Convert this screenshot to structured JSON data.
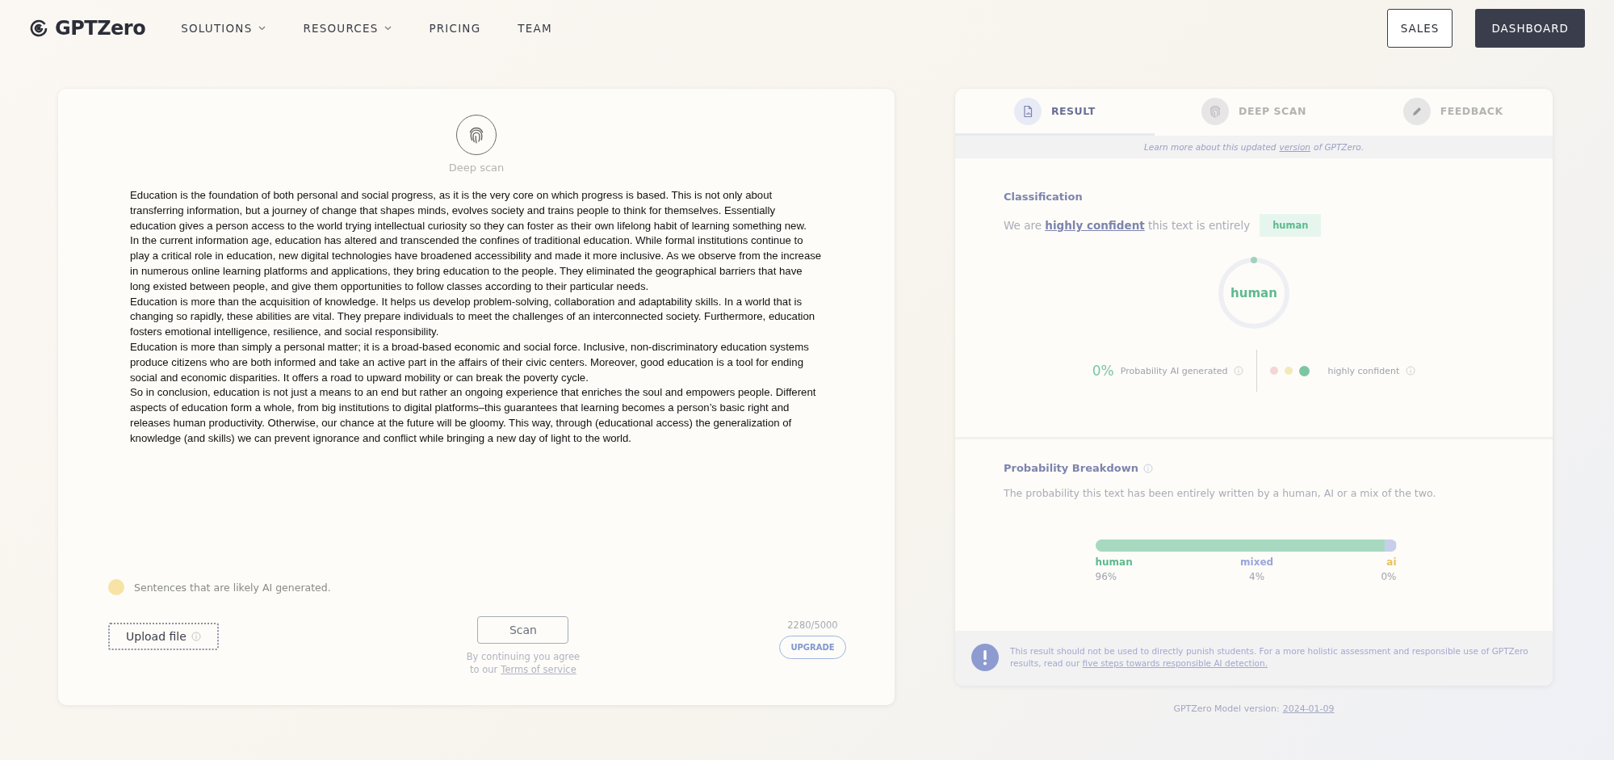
{
  "header": {
    "logo": "GPTZero",
    "nav": [
      {
        "label": "SOLUTIONS",
        "dropdown": true
      },
      {
        "label": "RESOURCES",
        "dropdown": true
      },
      {
        "label": "PRICING",
        "dropdown": false
      },
      {
        "label": "TEAM",
        "dropdown": false
      }
    ],
    "sales": "SALES",
    "dashboard": "DASHBOARD"
  },
  "editor": {
    "deep_scan_label": "Deep scan",
    "paragraphs": [
      "Education is the foundation of both personal and social progress, as it is the very core on which progress is based. This is not only about transferring information, but a journey of change that shapes minds, evolves society and trains people to think for themselves. Essentially education gives a person access to the world trying intellectual curiosity so they can foster as their own lifelong habit of learning something new.",
      "In the current information age, education has altered and transcended the confines of traditional education. While formal institutions continue to play a critical role in education, new digital technologies have broadened accessibility and made it more inclusive. As we observe from the increase in numerous online learning platforms and applications, they bring education to the people. They eliminated the geographical barriers that have long existed between people, and give them opportunities to follow classes according to their particular needs.",
      "Education is more than the acquisition of knowledge. It helps us develop problem-solving, collaboration and adaptability skills. In a world that is changing so rapidly, these abilities are vital. They prepare individuals to meet the challenges of an interconnected society. Furthermore, education fosters emotional intelligence, resilience, and social responsibility.",
      "Education is more than simply a personal matter; it is a broad-based economic and social force. Inclusive, non-discriminatory education systems produce citizens who are both informed and take an active part in the affairs of their civic centers. Moreover, good education is a tool for ending social and economic disparities. It offers a road to upward mobility or can break the poverty cycle.",
      "So in conclusion, education is not just a means to an end but rather an ongoing experience that enriches the soul and empowers people. Different aspects of education form a whole, from big institutions to digital platforms–this guarantees that learning becomes a person’s basic right and releases human productivity. Otherwise, our chance at the future will be gloomy. This way, through (educational access) the generalization of knowledge (and skills) we can prevent ignorance and conflict while bringing a new day of light to the world."
    ],
    "legend": {
      "label": "Sentences that are likely AI generated.",
      "color": "#f7e3a6"
    },
    "upload": "Upload file",
    "scan": "Scan",
    "agree_line": "By continuing you agree",
    "agree_prefix": "to our",
    "terms_link": "Terms of service",
    "count": "2280/5000",
    "upgrade": "UPGRADE"
  },
  "results": {
    "tabs": [
      {
        "label": "RESULT",
        "kind": "doc",
        "selected": true
      },
      {
        "label": "DEEP SCAN",
        "kind": "fingerprint",
        "selected": false
      },
      {
        "label": "FEEDBACK",
        "kind": "pencil",
        "selected": false
      }
    ],
    "banner": {
      "prefix": "Learn more about this updated",
      "link": "version",
      "suffix": "of GPTZero."
    },
    "classification": {
      "title": "Classification",
      "sentence": "We are **highly confident** this text is entirely",
      "badge": "human",
      "gauge_label": "human",
      "ai_percent": "0%",
      "ai_label": "Probability AI generated",
      "confidence_dots": [
        {
          "color": "#f3d6d3",
          "selected": false
        },
        {
          "color": "#f2eab8",
          "selected": false
        },
        {
          "color": "#7cc6a4",
          "selected": true
        }
      ],
      "confidence_label": "highly confident"
    },
    "breakdown": {
      "title": "Probability Breakdown",
      "description": "The probability this text has been entirely written by a human, AI or a mix of the two.",
      "segments": [
        {
          "label": "human",
          "value": "96%",
          "level": 0.96,
          "color": "#5fb98f"
        },
        {
          "label": "mixed",
          "value": "4%",
          "level": 0.04,
          "color": "#9aa6dc"
        },
        {
          "label": "ai",
          "value": "0%",
          "level": 0,
          "color": "#e9c35c"
        }
      ]
    },
    "notice": {
      "text": "This result should not be used to directly punish students. For a more holistic assessment and responsible use of GPTZero results, read our",
      "link": "five steps towards responsible AI detection."
    }
  },
  "footer": {
    "prefix": "GPTZero Model version:",
    "link": "2024-01-09"
  }
}
